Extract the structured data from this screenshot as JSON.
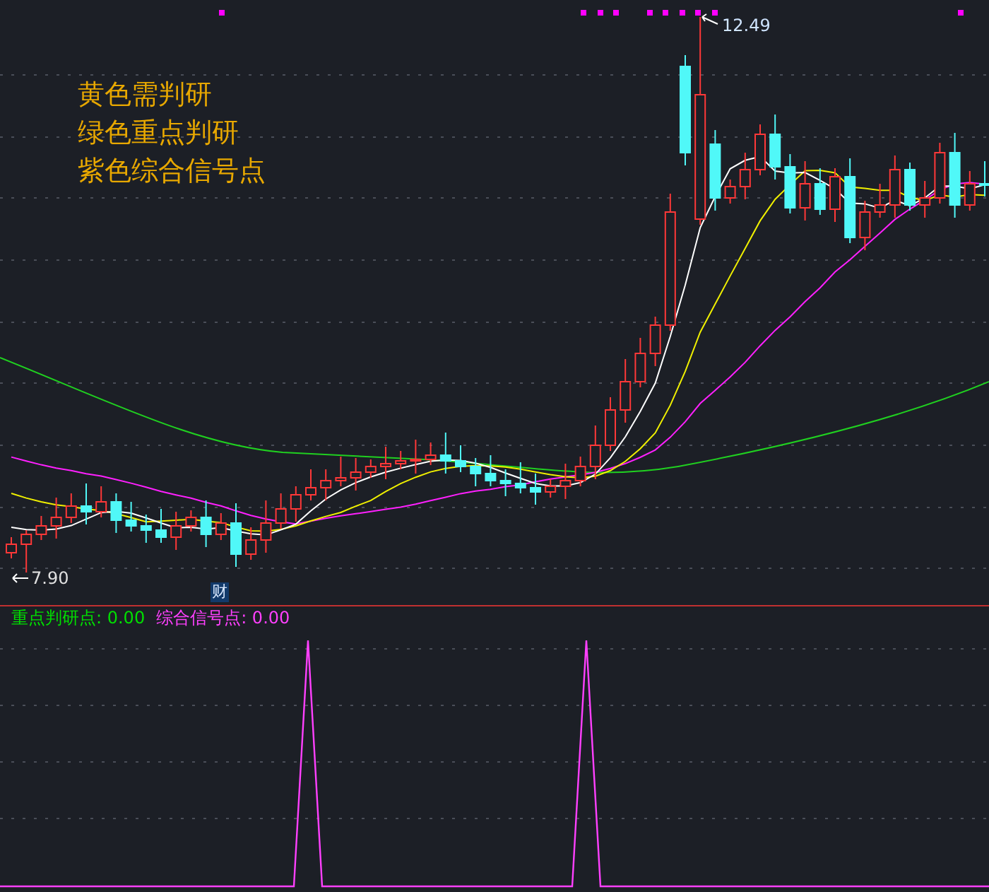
{
  "legend": [
    "黄色需判研",
    "绿色重点判研",
    "紫色综合信号点"
  ],
  "price_chart": {
    "high_label": "12.49",
    "low_label": "7.90",
    "event_badge": "财"
  },
  "indicator": {
    "items": [
      {
        "label": "重点判研点: 0.00",
        "color": "#00e000"
      },
      {
        "label": "综合信号点: 0.00",
        "color": "#ff40ff"
      }
    ]
  }
}
